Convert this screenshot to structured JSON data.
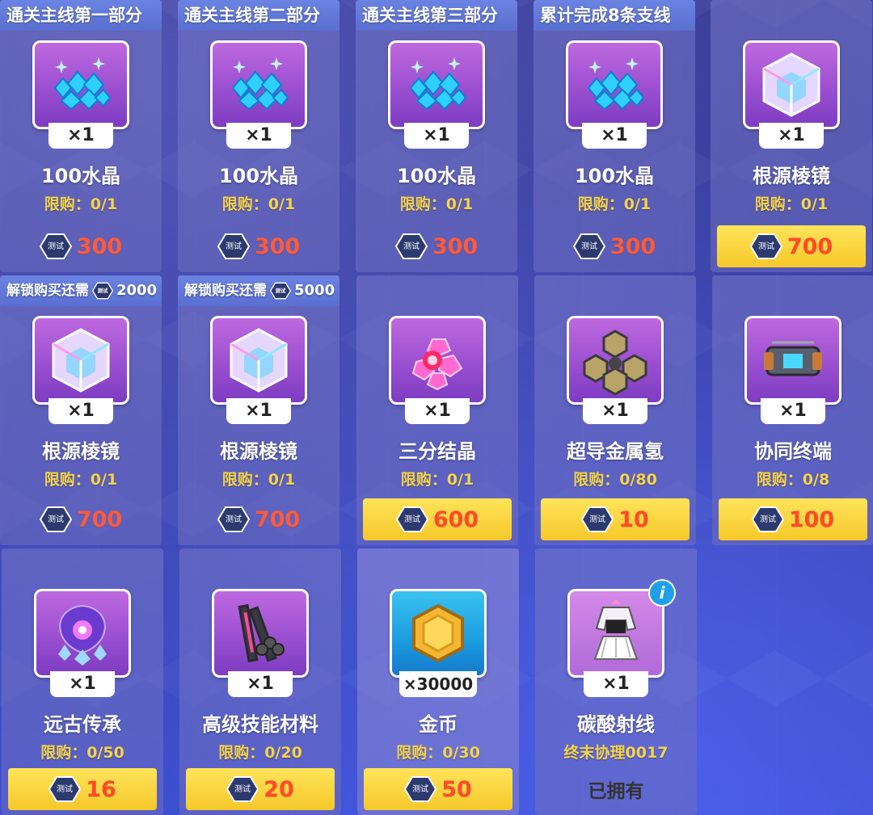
{
  "currency_icon_label": "测试",
  "colors": {
    "price_text": "#ff4a2a",
    "limit_text": "#f6d44a",
    "banner": "#6b83e2",
    "active_price_bg": "#f6c82a"
  },
  "rows": [
    [
      {
        "banner": "通关主线第一部分",
        "icon": "crystal-pile-icon",
        "qty": "×1",
        "name": "100水晶",
        "limit": "限购：0/1",
        "price": "300",
        "state": "locked"
      },
      {
        "banner": "通关主线第二部分",
        "icon": "crystal-pile-icon",
        "qty": "×1",
        "name": "100水晶",
        "limit": "限购：0/1",
        "price": "300",
        "state": "locked"
      },
      {
        "banner": "通关主线第三部分",
        "icon": "crystal-pile-icon",
        "qty": "×1",
        "name": "100水晶",
        "limit": "限购：0/1",
        "price": "300",
        "state": "locked"
      },
      {
        "banner": "累计完成8条支线",
        "icon": "crystal-pile-icon",
        "qty": "×1",
        "name": "100水晶",
        "limit": "限购：0/1",
        "price": "300",
        "state": "locked"
      },
      {
        "banner": "",
        "icon": "prism-cube-icon",
        "qty": "×1",
        "name": "根源棱镜",
        "limit": "限购：0/1",
        "price": "700",
        "state": "active"
      }
    ],
    [
      {
        "banner": "解锁购买还需",
        "unlock_amount": "2000",
        "icon": "prism-cube-icon",
        "qty": "×1",
        "name": "根源棱镜",
        "limit": "限购：0/1",
        "price": "700",
        "state": "locked"
      },
      {
        "banner": "解锁购买还需",
        "unlock_amount": "5000",
        "icon": "prism-cube-icon",
        "qty": "×1",
        "name": "根源棱镜",
        "limit": "限购：0/1",
        "price": "700",
        "state": "locked"
      },
      {
        "banner": "",
        "icon": "tri-crystal-icon",
        "qty": "×1",
        "name": "三分结晶",
        "limit": "限购：0/1",
        "price": "600",
        "state": "active"
      },
      {
        "banner": "",
        "icon": "metal-hex-icon",
        "qty": "×1",
        "name": "超导金属氢",
        "limit": "限购：0/80",
        "price": "10",
        "state": "active"
      },
      {
        "banner": "",
        "icon": "terminal-device-icon",
        "qty": "×1",
        "name": "协同终端",
        "limit": "限购：0/8",
        "price": "100",
        "state": "active"
      }
    ],
    [
      {
        "banner": "",
        "icon": "ancient-heritage-icon",
        "qty": "×1",
        "name": "远古传承",
        "limit": "限购：0/50",
        "price": "16",
        "state": "active"
      },
      {
        "banner": "",
        "icon": "skill-material-icon",
        "qty": "×1",
        "name": "高级技能材料",
        "limit": "限购：0/20",
        "price": "20",
        "state": "active"
      },
      {
        "banner": "",
        "icon": "gold-coin-icon",
        "qty": "×30000",
        "name": "金币",
        "limit": "限购：0/30",
        "price": "50",
        "state": "active"
      },
      {
        "banner": "",
        "icon": "outfit-icon",
        "qty": "×1",
        "name": "碳酸射线",
        "limit": "终末协理0017",
        "price": "已拥有",
        "state": "owned",
        "info": "i"
      }
    ]
  ]
}
